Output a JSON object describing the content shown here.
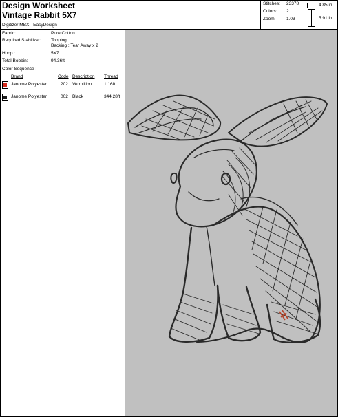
{
  "header": {
    "title": "Design Worksheet",
    "design_name": "Vintage Rabbit 5X7",
    "digitizer": "Digitizer MBX - EasyDesign"
  },
  "stats": {
    "stitches_label": "Stitches:",
    "stitches_value": "23378",
    "colors_label": "Colors:",
    "colors_value": "2",
    "zoom_label": "Zoom:",
    "zoom_value": "1.03",
    "width": "4.85 in",
    "height": "5.91 in"
  },
  "info": {
    "fabric_label": "Fabric:",
    "fabric_value": "Pure Cotton",
    "stabilizer_label": "Required Stabilizer:",
    "stabilizer_topping": "Topping:",
    "stabilizer_backing": "Backing : Tear Away x 2",
    "hoop_label": "Hoop :",
    "hoop_value": "5X7",
    "bobbin_label": "Total Bobbin:",
    "bobbin_value": "94.36ft"
  },
  "color_sequence": {
    "title": "Color Sequence :",
    "headers": {
      "brand": "Brand",
      "code": "Code",
      "description": "Description",
      "thread": "Thread"
    },
    "rows": [
      {
        "brand": "Janome Polyester",
        "code": "202",
        "description": "Vermillion",
        "thread": "1.16ft",
        "color": "#d42a1c"
      },
      {
        "brand": "Janome Polyester",
        "code": "002",
        "description": "Black",
        "thread": "344.28ft",
        "color": "#1a1a1a"
      }
    ]
  },
  "preview": {
    "background": "#c0c0c0",
    "stitch_color": "#2a2a2a",
    "accent_color": "#b5452a"
  }
}
